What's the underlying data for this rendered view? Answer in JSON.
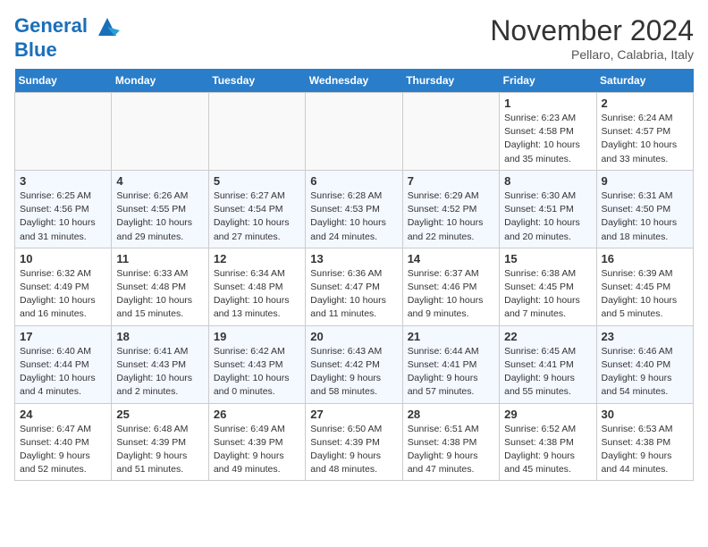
{
  "header": {
    "logo_line1": "General",
    "logo_line2": "Blue",
    "month_title": "November 2024",
    "location": "Pellaro, Calabria, Italy"
  },
  "weekdays": [
    "Sunday",
    "Monday",
    "Tuesday",
    "Wednesday",
    "Thursday",
    "Friday",
    "Saturday"
  ],
  "weeks": [
    [
      {
        "day": "",
        "info": ""
      },
      {
        "day": "",
        "info": ""
      },
      {
        "day": "",
        "info": ""
      },
      {
        "day": "",
        "info": ""
      },
      {
        "day": "",
        "info": ""
      },
      {
        "day": "1",
        "info": "Sunrise: 6:23 AM\nSunset: 4:58 PM\nDaylight: 10 hours and 35 minutes."
      },
      {
        "day": "2",
        "info": "Sunrise: 6:24 AM\nSunset: 4:57 PM\nDaylight: 10 hours and 33 minutes."
      }
    ],
    [
      {
        "day": "3",
        "info": "Sunrise: 6:25 AM\nSunset: 4:56 PM\nDaylight: 10 hours and 31 minutes."
      },
      {
        "day": "4",
        "info": "Sunrise: 6:26 AM\nSunset: 4:55 PM\nDaylight: 10 hours and 29 minutes."
      },
      {
        "day": "5",
        "info": "Sunrise: 6:27 AM\nSunset: 4:54 PM\nDaylight: 10 hours and 27 minutes."
      },
      {
        "day": "6",
        "info": "Sunrise: 6:28 AM\nSunset: 4:53 PM\nDaylight: 10 hours and 24 minutes."
      },
      {
        "day": "7",
        "info": "Sunrise: 6:29 AM\nSunset: 4:52 PM\nDaylight: 10 hours and 22 minutes."
      },
      {
        "day": "8",
        "info": "Sunrise: 6:30 AM\nSunset: 4:51 PM\nDaylight: 10 hours and 20 minutes."
      },
      {
        "day": "9",
        "info": "Sunrise: 6:31 AM\nSunset: 4:50 PM\nDaylight: 10 hours and 18 minutes."
      }
    ],
    [
      {
        "day": "10",
        "info": "Sunrise: 6:32 AM\nSunset: 4:49 PM\nDaylight: 10 hours and 16 minutes."
      },
      {
        "day": "11",
        "info": "Sunrise: 6:33 AM\nSunset: 4:48 PM\nDaylight: 10 hours and 15 minutes."
      },
      {
        "day": "12",
        "info": "Sunrise: 6:34 AM\nSunset: 4:48 PM\nDaylight: 10 hours and 13 minutes."
      },
      {
        "day": "13",
        "info": "Sunrise: 6:36 AM\nSunset: 4:47 PM\nDaylight: 10 hours and 11 minutes."
      },
      {
        "day": "14",
        "info": "Sunrise: 6:37 AM\nSunset: 4:46 PM\nDaylight: 10 hours and 9 minutes."
      },
      {
        "day": "15",
        "info": "Sunrise: 6:38 AM\nSunset: 4:45 PM\nDaylight: 10 hours and 7 minutes."
      },
      {
        "day": "16",
        "info": "Sunrise: 6:39 AM\nSunset: 4:45 PM\nDaylight: 10 hours and 5 minutes."
      }
    ],
    [
      {
        "day": "17",
        "info": "Sunrise: 6:40 AM\nSunset: 4:44 PM\nDaylight: 10 hours and 4 minutes."
      },
      {
        "day": "18",
        "info": "Sunrise: 6:41 AM\nSunset: 4:43 PM\nDaylight: 10 hours and 2 minutes."
      },
      {
        "day": "19",
        "info": "Sunrise: 6:42 AM\nSunset: 4:43 PM\nDaylight: 10 hours and 0 minutes."
      },
      {
        "day": "20",
        "info": "Sunrise: 6:43 AM\nSunset: 4:42 PM\nDaylight: 9 hours and 58 minutes."
      },
      {
        "day": "21",
        "info": "Sunrise: 6:44 AM\nSunset: 4:41 PM\nDaylight: 9 hours and 57 minutes."
      },
      {
        "day": "22",
        "info": "Sunrise: 6:45 AM\nSunset: 4:41 PM\nDaylight: 9 hours and 55 minutes."
      },
      {
        "day": "23",
        "info": "Sunrise: 6:46 AM\nSunset: 4:40 PM\nDaylight: 9 hours and 54 minutes."
      }
    ],
    [
      {
        "day": "24",
        "info": "Sunrise: 6:47 AM\nSunset: 4:40 PM\nDaylight: 9 hours and 52 minutes."
      },
      {
        "day": "25",
        "info": "Sunrise: 6:48 AM\nSunset: 4:39 PM\nDaylight: 9 hours and 51 minutes."
      },
      {
        "day": "26",
        "info": "Sunrise: 6:49 AM\nSunset: 4:39 PM\nDaylight: 9 hours and 49 minutes."
      },
      {
        "day": "27",
        "info": "Sunrise: 6:50 AM\nSunset: 4:39 PM\nDaylight: 9 hours and 48 minutes."
      },
      {
        "day": "28",
        "info": "Sunrise: 6:51 AM\nSunset: 4:38 PM\nDaylight: 9 hours and 47 minutes."
      },
      {
        "day": "29",
        "info": "Sunrise: 6:52 AM\nSunset: 4:38 PM\nDaylight: 9 hours and 45 minutes."
      },
      {
        "day": "30",
        "info": "Sunrise: 6:53 AM\nSunset: 4:38 PM\nDaylight: 9 hours and 44 minutes."
      }
    ]
  ]
}
